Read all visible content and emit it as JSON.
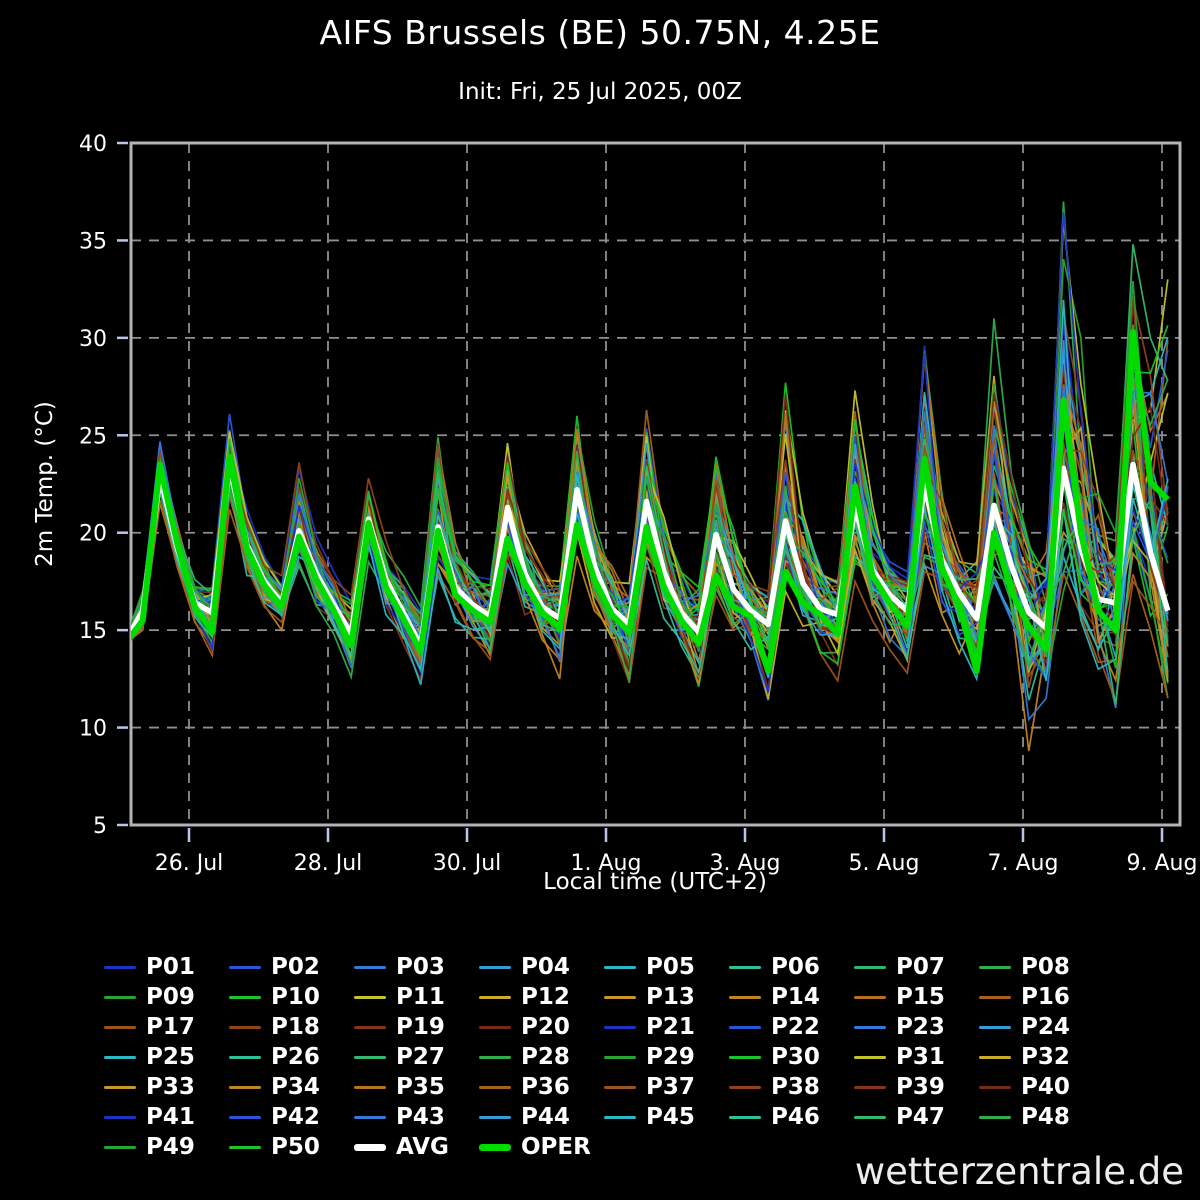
{
  "header": {
    "title": "AIFS Brussels (BE) 50.75N, 4.25E",
    "subtitle": "Init: Fri, 25 Jul 2025, 00Z"
  },
  "watermark": "wetterzentrale.de",
  "colors": {
    "background": "#000000",
    "avg": "#ffffff",
    "oper": "#00dc00",
    "grid": "#8f8f8f",
    "axis_border": "#b4b4b4",
    "tick": "#b9c6ea"
  },
  "chart_data": {
    "type": "line",
    "title": "AIFS Brussels (BE) 50.75N, 4.25E",
    "subtitle": "Init: Fri, 25 Jul 2025, 00Z",
    "xlabel": "Local time (UTC+2)",
    "ylabel": "2m Temp. (°C)",
    "ylim": [
      5,
      40
    ],
    "yticks": [
      5,
      10,
      15,
      20,
      25,
      30,
      35,
      40
    ],
    "grid": "dashed, both axes",
    "legend_position": "below plot, 8 columns",
    "time": {
      "description": "61 points, 6-hourly, local times 02/08/14/20 from Fri 25 Jul 2025 02:00 to Sat 9 Aug 2025 02:00",
      "step_hours": 6,
      "points": 61
    },
    "xticks": {
      "hours": [
        22,
        70,
        118,
        166,
        214,
        262,
        310,
        358
      ],
      "labels": [
        "26. Jul",
        "28. Jul",
        "30. Jul",
        "1. Aug",
        "3. Aug",
        "5. Aug",
        "7. Aug",
        "9. Aug"
      ]
    },
    "avg": [
      14.4,
      16.0,
      22.9,
      19.2,
      16.4,
      15.9,
      23.4,
      19.4,
      17.5,
      16.4,
      20.1,
      17.9,
      16.3,
      14.8,
      20.7,
      17.6,
      15.9,
      14.2,
      20.3,
      17.2,
      16.3,
      15.7,
      21.3,
      17.9,
      16.2,
      15.6,
      22.2,
      18.3,
      16.1,
      15.3,
      21.6,
      18.0,
      15.9,
      14.9,
      19.9,
      17.1,
      16.0,
      15.3,
      20.6,
      17.4,
      16.1,
      15.8,
      21.3,
      18.1,
      16.8,
      16.0,
      22.4,
      18.6,
      16.9,
      15.6,
      21.4,
      18.3,
      15.9,
      15.1,
      23.3,
      19.2,
      16.6,
      16.4,
      23.5,
      19.0,
      16.0
    ],
    "oper": [
      14.3,
      15.5,
      23.5,
      19.4,
      16.2,
      14.9,
      23.9,
      19.2,
      17.3,
      16.2,
      19.8,
      17.6,
      16.0,
      14.2,
      20.5,
      17.2,
      15.6,
      13.9,
      20.1,
      16.8,
      16.0,
      15.4,
      19.7,
      17.4,
      15.9,
      15.1,
      20.4,
      17.6,
      15.8,
      14.9,
      20.3,
      17.2,
      15.5,
      14.3,
      17.8,
      16.2,
      15.7,
      12.9,
      18.0,
      16.4,
      15.8,
      14.8,
      22.4,
      17.8,
      16.4,
      15.2,
      23.8,
      18.2,
      16.2,
      12.9,
      20.0,
      17.0,
      15.2,
      14.0,
      26.8,
      20.0,
      16.0,
      15.0,
      30.3,
      22.6,
      21.7
    ],
    "env_min": [
      14.2,
      15.0,
      21.5,
      18.2,
      15.4,
      13.7,
      21.2,
      17.8,
      16.2,
      15.0,
      18.3,
      16.2,
      14.8,
      12.6,
      18.5,
      15.8,
      14.3,
      12.2,
      17.8,
      15.4,
      14.6,
      13.5,
      18.4,
      15.8,
      14.5,
      12.5,
      18.8,
      16.0,
      14.6,
      12.3,
      18.2,
      15.6,
      14.2,
      12.1,
      16.8,
      15.0,
      14.0,
      11.4,
      17.0,
      15.2,
      13.8,
      12.4,
      17.5,
      15.5,
      14.0,
      12.8,
      18.0,
      15.8,
      13.8,
      12.5,
      17.5,
      15.5,
      8.8,
      11.5,
      17.0,
      15.5,
      13.0,
      11.0,
      17.5,
      15.0,
      11.5
    ],
    "env_max": [
      14.6,
      17.0,
      24.7,
      20.4,
      17.6,
      17.2,
      26.1,
      21.2,
      18.8,
      17.8,
      23.6,
      19.8,
      18.0,
      16.8,
      22.8,
      19.6,
      17.8,
      16.2,
      24.9,
      19.5,
      18.0,
      17.6,
      24.6,
      20.0,
      18.2,
      17.5,
      26.0,
      20.6,
      18.3,
      17.4,
      26.3,
      20.8,
      18.0,
      17.2,
      23.9,
      20.2,
      17.8,
      17.0,
      27.7,
      21.0,
      18.2,
      17.6,
      27.3,
      21.5,
      18.5,
      18.0,
      29.6,
      22.0,
      19.0,
      18.5,
      31.0,
      23.0,
      19.5,
      19.0,
      37.0,
      30.0,
      22.0,
      20.0,
      34.8,
      30.0,
      33.0
    ],
    "members": {
      "count": 50,
      "labels": [
        "P01",
        "P02",
        "P03",
        "P04",
        "P05",
        "P06",
        "P07",
        "P08",
        "P09",
        "P10",
        "P11",
        "P12",
        "P13",
        "P14",
        "P15",
        "P16",
        "P17",
        "P18",
        "P19",
        "P20",
        "P21",
        "P22",
        "P23",
        "P24",
        "P25",
        "P26",
        "P27",
        "P28",
        "P29",
        "P30",
        "P31",
        "P32",
        "P33",
        "P34",
        "P35",
        "P36",
        "P37",
        "P38",
        "P39",
        "P40",
        "P41",
        "P42",
        "P43",
        "P44",
        "P45",
        "P46",
        "P47",
        "P48",
        "P49",
        "P50"
      ],
      "palette": [
        "#1d33c4",
        "#2b55d8",
        "#3379d8",
        "#349cd6",
        "#2db6c6",
        "#2fbf9b",
        "#31b86e",
        "#2fad49",
        "#28a432",
        "#1dc228",
        "#c3c32a",
        "#c9ad26",
        "#c79824",
        "#c08522",
        "#b57120",
        "#a9601e",
        "#9e521d",
        "#91421b",
        "#853419",
        "#782a17"
      ]
    }
  },
  "legend": {
    "avg_label": "AVG",
    "oper_label": "OPER"
  }
}
